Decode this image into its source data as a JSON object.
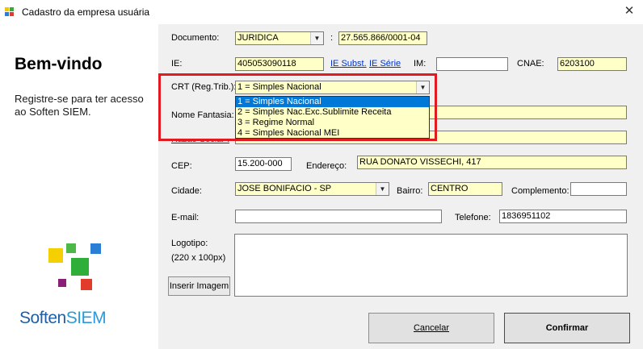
{
  "window": {
    "title": "Cadastro da empresa usuária",
    "close_glyph": "✕"
  },
  "left": {
    "welcome": "Bem-vindo",
    "subtitle": "Registre-se para ter acesso ao Soften SIEM.",
    "brand_a": "Soften",
    "brand_b": "SIEM"
  },
  "form": {
    "documento_label": "Documento:",
    "documento_type": "JURIDICA",
    "doc_sep": ":",
    "documento_value": "27.565.866/0001-04",
    "ie_label": "IE:",
    "ie_value": "405053090118",
    "ie_subst_link": "IE Subst.",
    "ie_serie_link": "IE Série",
    "im_label": "IM:",
    "im_value": "",
    "cnae_label": "CNAE:",
    "cnae_value": "6203100",
    "crt_label": "CRT (Reg.Trib.):",
    "crt_value": "1 = Simples Nacional",
    "crt_options": [
      "1 = Simples Nacional",
      "2 = Simples Nac.Exc.Sublimite Receita",
      "3 = Regime Normal",
      "4 = Simples Nacional MEI"
    ],
    "nome_fantasia_label": "Nome Fantasia:",
    "razao_social_label": "Razão Social*:",
    "cep_label": "CEP:",
    "cep_value": "15.200-000",
    "endereco_label": "Endereço:",
    "endereco_value": "RUA DONATO VISSECHI, 417",
    "cidade_label": "Cidade:",
    "cidade_value": "JOSE BONIFACIO - SP",
    "bairro_label": "Bairro:",
    "bairro_value": "CENTRO",
    "complemento_label": "Complemento:",
    "complemento_value": "",
    "email_label": "E-mail:",
    "email_value": "",
    "telefone_label": "Telefone:",
    "telefone_value": "1836951102",
    "logotipo_label": "Logotipo:",
    "logotipo_size": "(220 x 100px)",
    "inserir_imagem": "Inserir Imagem"
  },
  "buttons": {
    "cancelar": "Cancelar",
    "confirmar": "Confirmar"
  },
  "colors": {
    "highlight": "#e11a22",
    "field_yellow": "#ffffc8",
    "link_blue": "#0033cc",
    "brand_blue": "#1f5fa8",
    "brand_teal": "#2a9ad8"
  }
}
